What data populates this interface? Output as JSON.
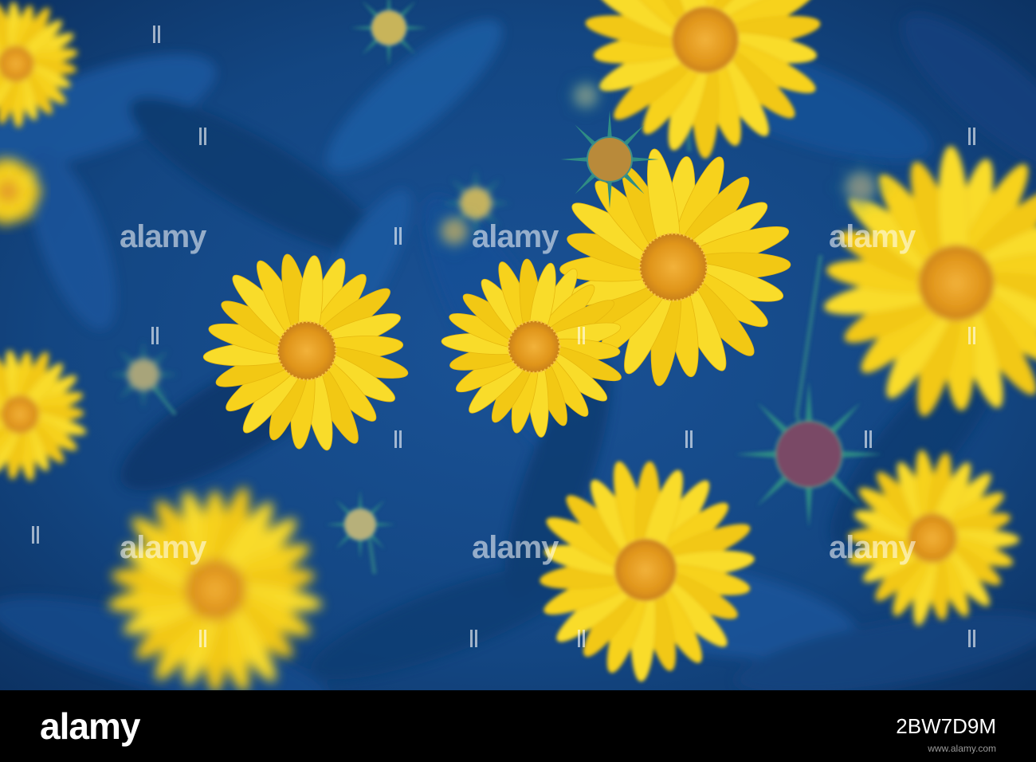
{
  "photo": {
    "subject": "yellow flowers",
    "colors": {
      "background": "#123e74",
      "petal": "#f7d21c",
      "center": "#e09a14",
      "bud": "#2f8c84"
    }
  },
  "watermark": {
    "text": "alamy"
  },
  "footer": {
    "brand": "alamy",
    "image_id": "2BW7D9M",
    "url": "www.alamy.com"
  }
}
